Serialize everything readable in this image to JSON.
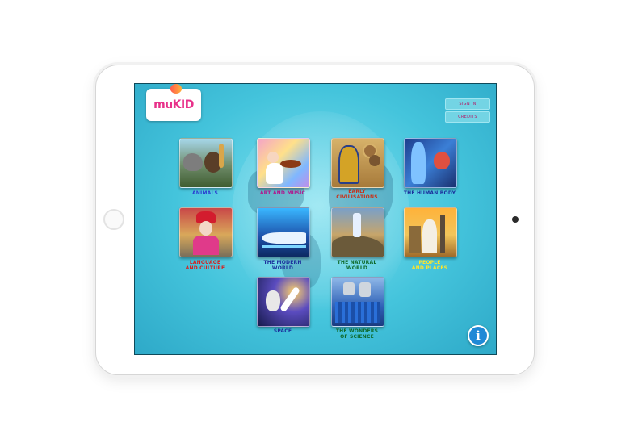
{
  "header": {
    "logo_text": "muKID"
  },
  "buttons": {
    "sign_in": "SIGN IN",
    "credits": "CREDITS"
  },
  "categories": [
    {
      "label": "ANIMALS",
      "color": "#2a3fd1"
    },
    {
      "label": "ART AND MUSIC",
      "color": "#b0178e"
    },
    {
      "label": "EARLY\nCIVILISATIONS",
      "color": "#c8321a"
    },
    {
      "label": "THE HUMAN BODY",
      "color": "#1b2f9c"
    },
    {
      "label": "LANGUAGE\nAND CULTURE",
      "color": "#d81d1d"
    },
    {
      "label": "THE MODERN\nWORLD",
      "color": "#1b2f9c"
    },
    {
      "label": "THE NATURAL\nWORLD",
      "color": "#0f6a2c"
    },
    {
      "label": "PEOPLE\nAND PLACES",
      "color": "#ffe52a"
    },
    {
      "label": "SPACE",
      "color": "#1b2f9c"
    },
    {
      "label": "THE WONDERS\nOF SCIENCE",
      "color": "#0f6a2c"
    }
  ],
  "icons": {
    "info": "i"
  }
}
